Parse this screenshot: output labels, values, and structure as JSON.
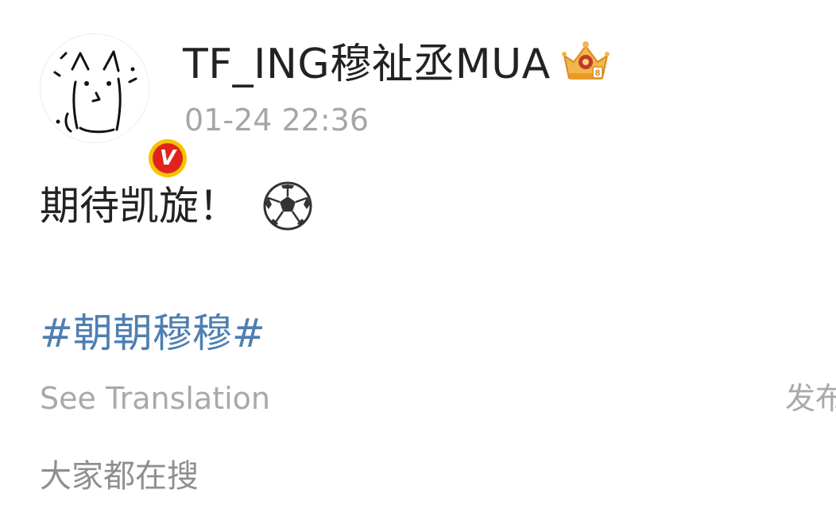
{
  "post": {
    "author": {
      "name": "TF_ING穆祉丞MUA",
      "verified_badge": "V",
      "avatar_icon": "doodle-cat-avatar",
      "member_badge_icon": "crown-badge-icon"
    },
    "timestamp": "01-24 22:36",
    "text": "期待凯旋！",
    "emoji": "⚽",
    "hashtag": "#朝朝穆穆#",
    "see_translation": "See Translation",
    "publish_label": "发布",
    "trending_label": "大家都在搜"
  },
  "colors": {
    "hashtag": "#4f7fb2",
    "verified_badge_bg": "#e0241d",
    "verified_badge_ring": "#f6c400",
    "meta_text": "#a6a6a6",
    "primary_text": "#222222"
  }
}
